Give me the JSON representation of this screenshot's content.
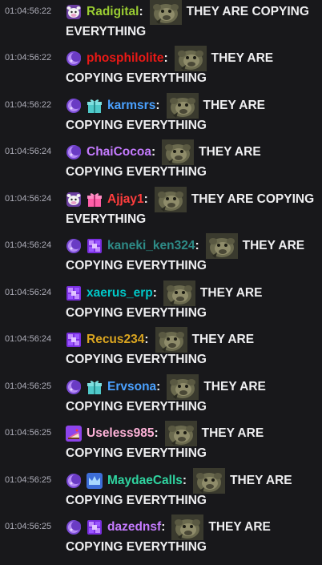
{
  "messages": [
    {
      "time": "01:04:56:22",
      "badges": [
        "cow-badge-icon"
      ],
      "user": "Radigital",
      "color": "#9acd32",
      "line1": "THEY ARE COPYING",
      "line2": "EVERYTHING"
    },
    {
      "time": "01:04:56:22",
      "badges": [
        "purple-crescent-badge-icon"
      ],
      "user": "phosphilolite",
      "color": "#e91916",
      "line1": "THEY ARE",
      "line2": "COPYING EVERYTHING"
    },
    {
      "time": "01:04:56:22",
      "badges": [
        "purple-crescent-badge-icon",
        "gift-teal-badge-icon"
      ],
      "user": "karmsrs",
      "color": "#4aa1ff",
      "line1": "THEY ARE",
      "line2": "COPYING EVERYTHING"
    },
    {
      "time": "01:04:56:24",
      "badges": [
        "purple-crescent-badge-icon"
      ],
      "user": "ChaiCocoa",
      "color": "#c57bff",
      "line1": "THEY ARE",
      "line2": "COPYING EVERYTHING"
    },
    {
      "time": "01:04:56:24",
      "badges": [
        "cow-badge-icon",
        "gift-pink-badge-icon"
      ],
      "user": "Ajjay1",
      "color": "#ff3d3d",
      "line1": "THEY ARE COPYING",
      "line2": "EVERYTHING"
    },
    {
      "time": "01:04:56:24",
      "badges": [
        "purple-crescent-badge-icon",
        "purple-gem-badge-icon"
      ],
      "user": "kaneki_ken324",
      "color": "#2e8b87",
      "line1": "THEY ARE",
      "line2": "COPYING EVERYTHING"
    },
    {
      "time": "01:04:56:24",
      "badges": [
        "purple-gem-badge-icon"
      ],
      "user": "xaerus_erp",
      "color": "#00c8c8",
      "line1": "THEY ARE",
      "line2": "COPYING EVERYTHING"
    },
    {
      "time": "01:04:56:24",
      "badges": [
        "purple-gem-badge-icon"
      ],
      "user": "Recus234",
      "color": "#daa520",
      "line1": "THEY ARE",
      "line2": "COPYING EVERYTHING"
    },
    {
      "time": "01:04:56:25",
      "badges": [
        "purple-crescent-badge-icon",
        "gift-teal-badge-icon"
      ],
      "user": "Ervsona",
      "color": "#4aa1ff",
      "line1": "THEY ARE",
      "line2": "COPYING EVERYTHING"
    },
    {
      "time": "01:04:56:25",
      "badges": [
        "cake-badge-icon"
      ],
      "user": "Useless985",
      "color": "#ffb3d9",
      "line1": "THEY ARE",
      "line2": "COPYING EVERYTHING"
    },
    {
      "time": "01:04:56:25",
      "badges": [
        "purple-crescent-badge-icon",
        "crown-blue-badge-icon"
      ],
      "user": "MaydaeCalls",
      "color": "#2fd4a0",
      "line1": "THEY ARE",
      "line2": "COPYING EVERYTHING"
    },
    {
      "time": "01:04:56:25",
      "badges": [
        "purple-crescent-badge-icon",
        "purple-gem-badge-icon"
      ],
      "user": "dazednsf",
      "color": "#c57bff",
      "line1": "THEY ARE",
      "line2": "COPYING EVERYTHING"
    }
  ],
  "emote": "monkey-emote-icon",
  "colon": ":"
}
